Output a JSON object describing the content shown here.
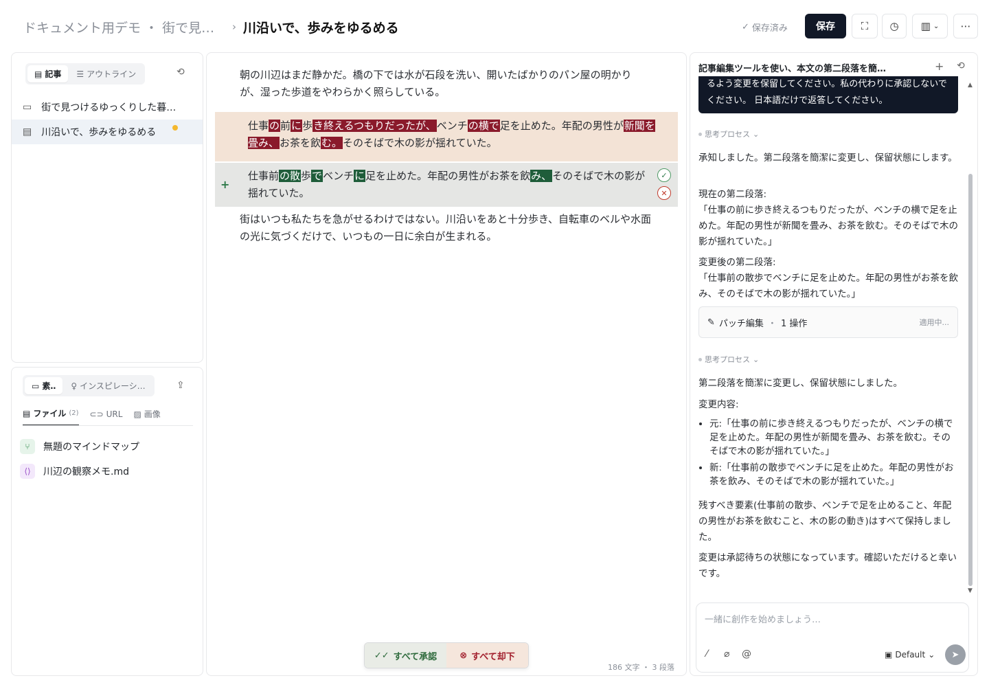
{
  "header": {
    "breadcrumb_parent": "ドキュメント用デモ ・ 街で見…",
    "breadcrumb_sep": "›",
    "breadcrumb_current": "川沿いで、歩みをゆるめる",
    "saved_status": "保存済み",
    "save_label": "保存"
  },
  "sidebar": {
    "tabs": [
      {
        "label": "記事"
      },
      {
        "label": "アウトライン"
      }
    ],
    "tree": [
      {
        "label": "街で見つけるゆっくりした暮…"
      },
      {
        "label": "川沿いで、歩みをゆるめる"
      }
    ],
    "resources": {
      "tabs": [
        {
          "label": "素‥"
        },
        {
          "label": "インスピレーシ…"
        }
      ],
      "subtabs": [
        {
          "label": "ファイル",
          "count": "(2)"
        },
        {
          "label": "URL"
        },
        {
          "label": "画像"
        }
      ],
      "files": [
        {
          "label": "無題のマインドマップ"
        },
        {
          "label": "川辺の観察メモ.md"
        }
      ]
    }
  },
  "editor": {
    "para1": "朝の川辺はまだ静かだ。橋の下では水が石段を洗い、開いたばかりのパン屋の明かりが、湿った歩道をやわらかく照らしている。",
    "deleted_segments": [
      {
        "t": "仕事",
        "d": false
      },
      {
        "t": "の",
        "d": true
      },
      {
        "t": "前",
        "d": false
      },
      {
        "t": "に",
        "d": true
      },
      {
        "t": "歩",
        "d": false
      },
      {
        "t": "き終えるつもりだったが、",
        "d": true
      },
      {
        "t": "ベンチ",
        "d": false
      },
      {
        "t": "の横で",
        "d": true
      },
      {
        "t": "足を止めた。年配の男性が",
        "d": false
      },
      {
        "t": "新聞を畳み、",
        "d": true
      },
      {
        "t": "お茶を飲",
        "d": false
      },
      {
        "t": "む。",
        "d": true
      },
      {
        "t": "そのそばで木の影が揺れていた。",
        "d": false
      }
    ],
    "added_segments": [
      {
        "t": "仕事前",
        "d": false
      },
      {
        "t": "の散",
        "d": true
      },
      {
        "t": "歩",
        "d": false
      },
      {
        "t": "で",
        "d": true
      },
      {
        "t": "ベンチ",
        "d": false
      },
      {
        "t": "に",
        "d": true
      },
      {
        "t": "足を止めた。年配の男性がお茶を飲",
        "d": false
      },
      {
        "t": "み、",
        "d": true
      },
      {
        "t": "そのそばで木の影が揺れていた。",
        "d": false
      }
    ],
    "para3": "街はいつも私たちを急がせるわけではない。川沿いをあと十分歩き、自転車のベルや水面の光に気づくだけで、いつもの一日に余白が生まれる。",
    "accept_all": "すべて承認",
    "reject_all": "すべて却下",
    "wordcount": "186 文字 ・ 3 段落"
  },
  "chat": {
    "title": "記事編集ツールを使い、本文の第二段落を簡…",
    "user_message": "るよう変更を保留してください。私の代わりに承認しないでください。 日本語だけで返答してください。",
    "thinking_label": "思考プロセス",
    "reply1": "承知しました。第二段落を簡潔に変更し、保留状態にします。",
    "current_label": "現在の第二段落:",
    "current_text": "「仕事の前に歩き終えるつもりだったが、ベンチの横で足を止めた。年配の男性が新聞を畳み、お茶を飲む。そのそばで木の影が揺れていた。」",
    "after_label": "変更後の第二段落:",
    "after_text": "「仕事前の散歩でベンチに足を止めた。年配の男性がお茶を飲み、そのそばで木の影が揺れていた。」",
    "patch_label": "パッチ編集",
    "patch_ops": "1 操作",
    "patch_status": "適用中...",
    "reply2": "第二段落を簡潔に変更し、保留状態にしました。",
    "changes_label": "変更内容:",
    "change_old": "元:「仕事の前に歩き終えるつもりだったが、ベンチの横で足を止めた。年配の男性が新聞を畳み、お茶を飲む。そのそばで木の影が揺れていた。」",
    "change_new": "新:「仕事前の散歩でベンチに足を止めた。年配の男性がお茶を飲み、そのそばで木の影が揺れていた。」",
    "reply3": "残すべき要素(仕事前の散歩、ベンチで足を止めること、年配の男性がお茶を飲むこと、木の影の動き)はすべて保持しました。",
    "reply4": "変更は承認待ちの状態になっています。確認いただけると幸いです。",
    "composer_placeholder": "一緒に創作を始めましょう…",
    "model_label": "Default"
  }
}
